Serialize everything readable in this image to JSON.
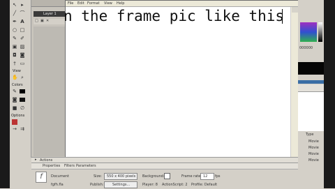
{
  "tools_panel": {
    "header": "View",
    "colors_header": "Colors",
    "options_header": "Options",
    "letter_tool": "A"
  },
  "timeline": {
    "layer_name": "Layer 1"
  },
  "notepad": {
    "menu": [
      "File",
      "Edit",
      "Format",
      "View",
      "Help"
    ],
    "text": "n the frame pic like this"
  },
  "right_panel": {
    "hex_value": "000000",
    "type_header": "Type",
    "list_items": [
      "Movie",
      "Movie",
      "Movie",
      "Movie"
    ]
  },
  "bottom_panel": {
    "actions_label": "Actions",
    "properties_tab": "Properties",
    "filters_tab": "Filters",
    "parameters_tab": "Parameters",
    "document_label": "Document",
    "file_name": "fgfh.fla",
    "size_label": "Size:",
    "size_value": "550 x 400 pixels",
    "background_label": "Background:",
    "frame_rate_label": "Frame rate:",
    "frame_rate_value": "12",
    "fps_label": "fps",
    "publish_label": "Publish:",
    "settings_button": "Settings...",
    "player_label": "Player: 8",
    "actionscript_label": "ActionScript: 2",
    "profile_label": "Profile: Default"
  },
  "colors": {
    "dark_bg": "#1a1a1a",
    "panel_bg": "#d4d0c8",
    "accent_blue": "#3a6ea5"
  }
}
